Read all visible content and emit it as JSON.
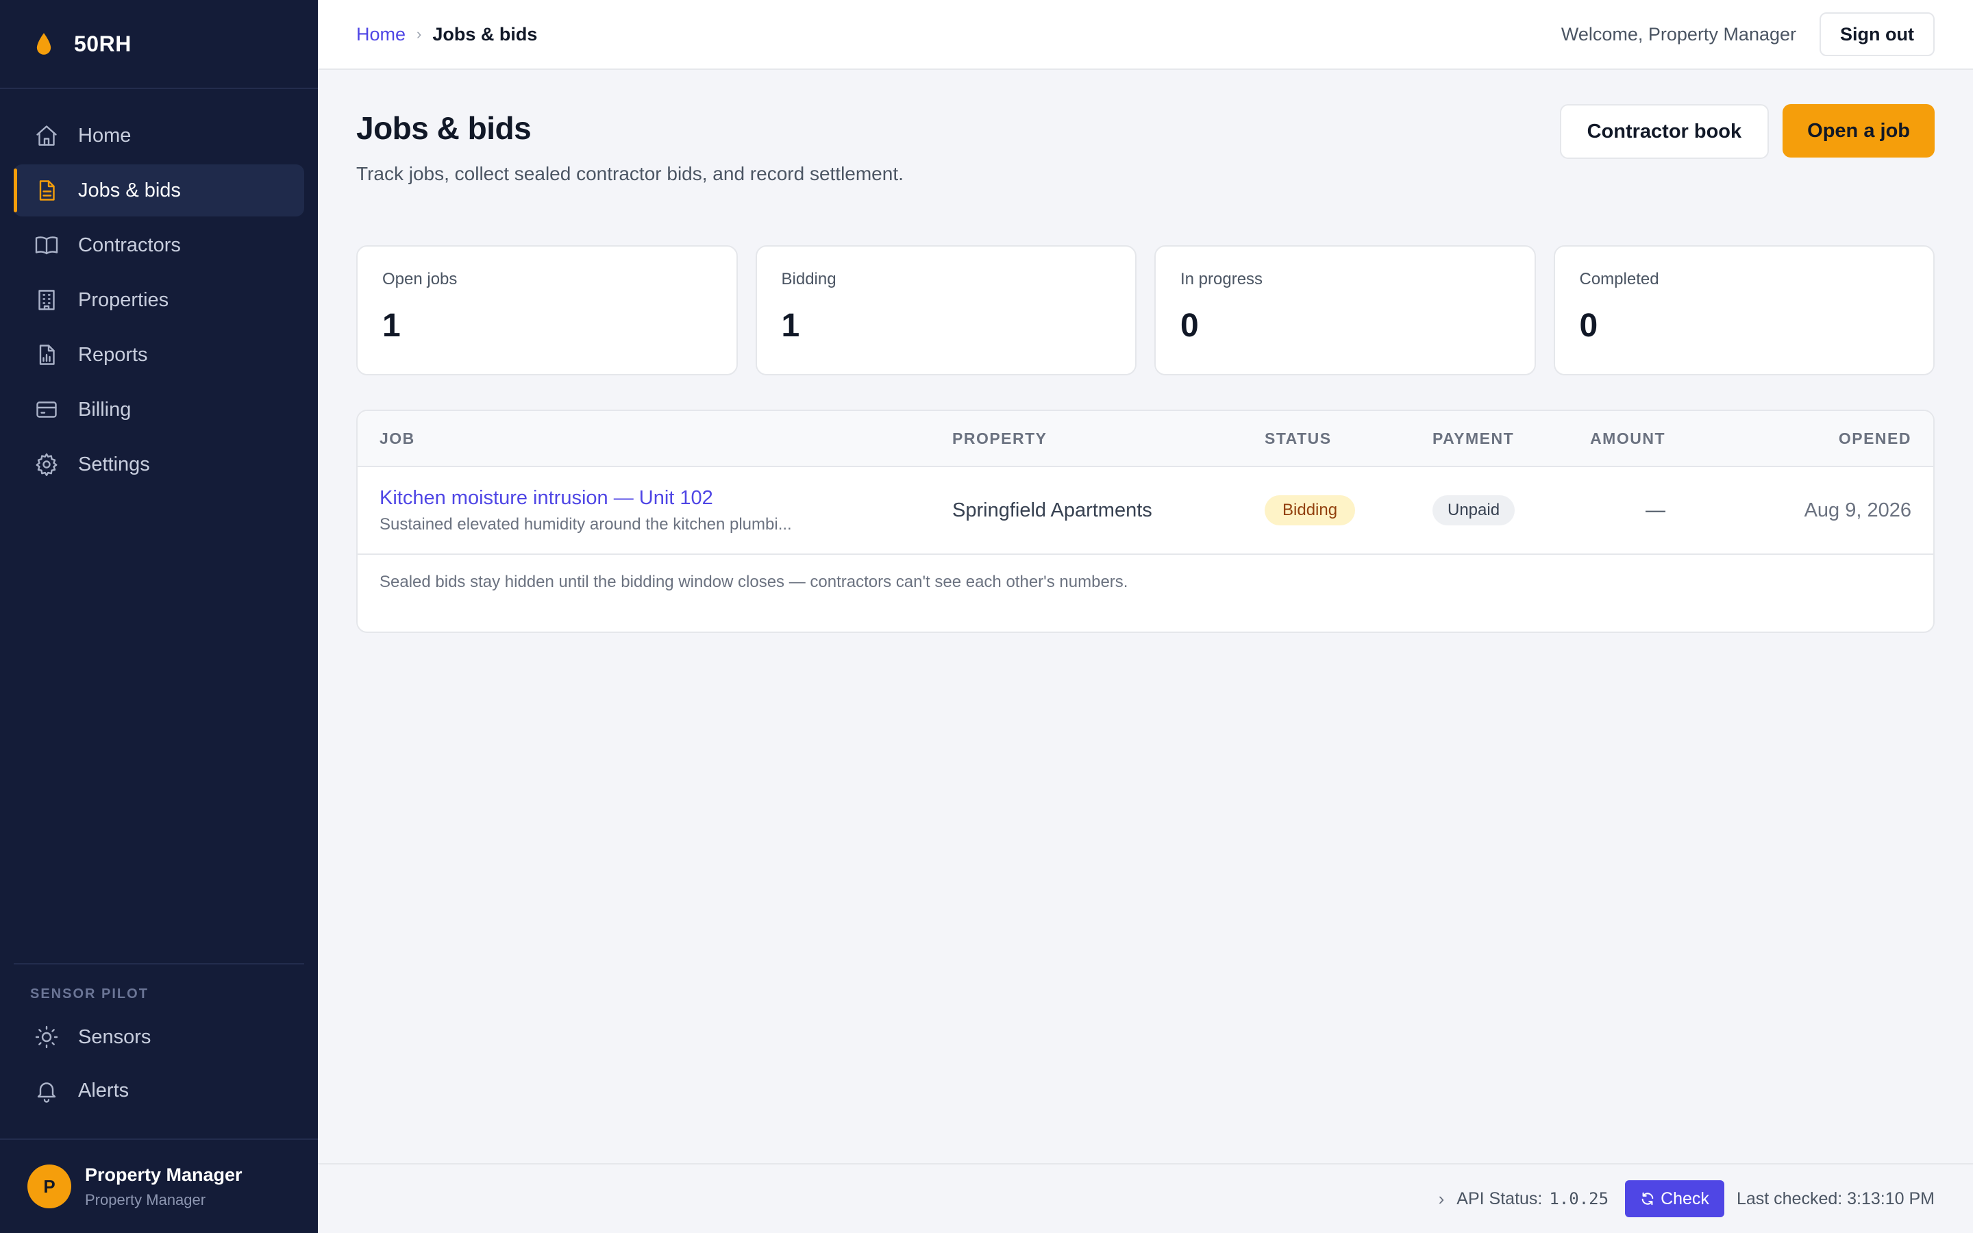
{
  "brand": {
    "name": "50RH",
    "accent": "#f59e0b"
  },
  "sidebar": {
    "items": [
      {
        "label": "Home",
        "icon": "home-icon"
      },
      {
        "label": "Jobs & bids",
        "icon": "document-icon",
        "active": true
      },
      {
        "label": "Contractors",
        "icon": "book-icon"
      },
      {
        "label": "Properties",
        "icon": "building-icon"
      },
      {
        "label": "Reports",
        "icon": "report-icon"
      },
      {
        "label": "Billing",
        "icon": "card-icon"
      },
      {
        "label": "Settings",
        "icon": "gear-icon"
      }
    ],
    "section_label": "SENSOR PILOT",
    "section_items": [
      {
        "label": "Sensors",
        "icon": "sun-icon"
      },
      {
        "label": "Alerts",
        "icon": "bell-icon"
      }
    ],
    "user": {
      "initial": "P",
      "name": "Property Manager",
      "role": "Property Manager"
    }
  },
  "topbar": {
    "breadcrumb_home": "Home",
    "breadcrumb_sep": "›",
    "breadcrumb_current": "Jobs & bids",
    "welcome": "Welcome, Property Manager",
    "sign_out": "Sign out"
  },
  "page": {
    "title": "Jobs & bids",
    "subtitle": "Track jobs, collect sealed contractor bids, and record settlement.",
    "contractor_book": "Contractor book",
    "open_job": "Open a job"
  },
  "stats": [
    {
      "label": "Open jobs",
      "value": "1"
    },
    {
      "label": "Bidding",
      "value": "1"
    },
    {
      "label": "In progress",
      "value": "0"
    },
    {
      "label": "Completed",
      "value": "0"
    }
  ],
  "table": {
    "headers": {
      "job": "JOB",
      "property": "PROPERTY",
      "status": "STATUS",
      "payment": "PAYMENT",
      "amount": "AMOUNT",
      "opened": "OPENED"
    },
    "rows": [
      {
        "title": "Kitchen moisture intrusion — Unit 102",
        "desc": "Sustained elevated humidity around the kitchen plumbi...",
        "property": "Springfield Apartments",
        "status": "Bidding",
        "payment": "Unpaid",
        "amount": "—",
        "opened": "Aug 9, 2026"
      }
    ],
    "footnote": "Sealed bids stay hidden until the bidding window closes — contractors can't see each other's numbers."
  },
  "statusbar": {
    "chevron": "›",
    "api_label": "API Status:",
    "version": "1.0.25",
    "check": "Check",
    "last_checked": "Last checked: 3:13:10 PM"
  }
}
